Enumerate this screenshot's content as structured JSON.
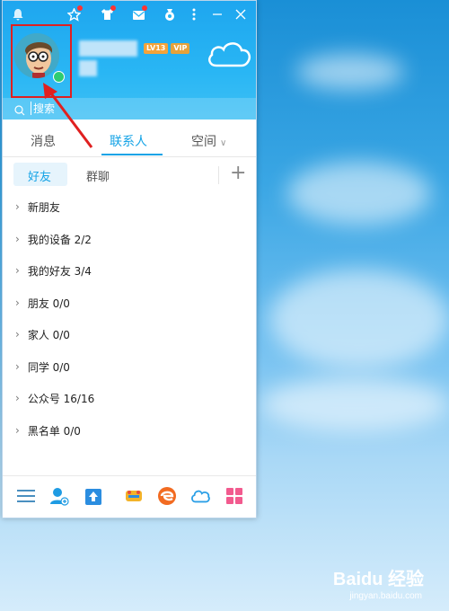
{
  "header": {
    "badges": {
      "level": "LV13",
      "vip": "VIP"
    },
    "search_placeholder": "搜索"
  },
  "tabs": [
    {
      "label": "消息"
    },
    {
      "label": "联系人",
      "active": true
    },
    {
      "label": "空间"
    }
  ],
  "subtabs": [
    {
      "label": "好友",
      "active": true
    },
    {
      "label": "群聊"
    }
  ],
  "groups": [
    {
      "label": "新朋友"
    },
    {
      "label": "我的设备 2/2"
    },
    {
      "label": "我的好友 3/4"
    },
    {
      "label": "朋友 0/0"
    },
    {
      "label": "家人 0/0"
    },
    {
      "label": "同学 0/0"
    },
    {
      "label": "公众号 16/16"
    },
    {
      "label": "黑名单 0/0"
    }
  ],
  "watermark": {
    "brand": "Baidu 经验",
    "url": "jingyan.baidu.com"
  },
  "colors": {
    "accent": "#14a3e6",
    "header": "#29b6f4",
    "highlight": "#e02020"
  }
}
